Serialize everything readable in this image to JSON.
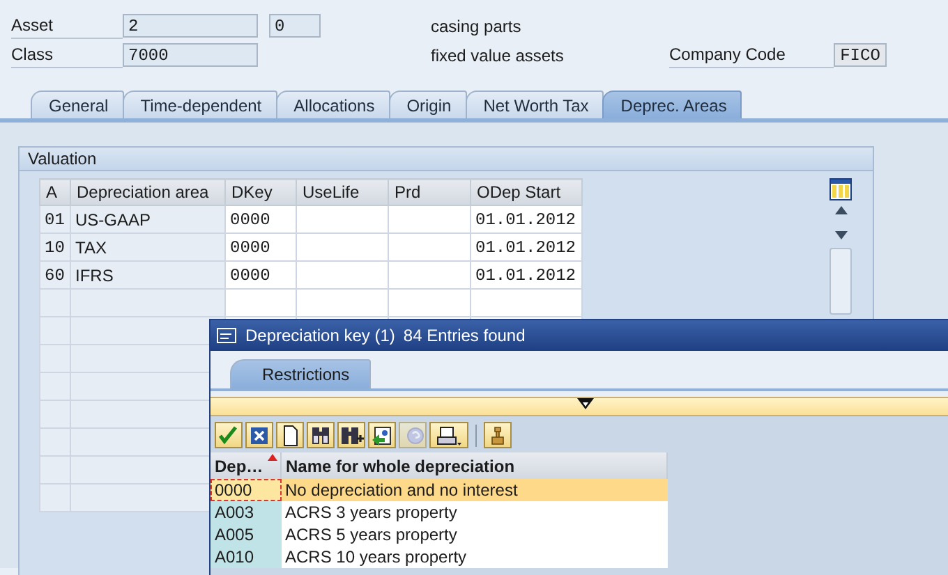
{
  "header": {
    "rows": [
      {
        "label": "Asset",
        "fields": [
          "2",
          "0"
        ],
        "description": "casing parts"
      },
      {
        "label": "Class",
        "fields": [
          "7000"
        ],
        "description": "fixed value assets",
        "extra_label": "Company Code",
        "extra_value": "FICO"
      }
    ]
  },
  "tabs": [
    {
      "label": "General",
      "selected": false
    },
    {
      "label": "Time-dependent",
      "selected": false
    },
    {
      "label": "Allocations",
      "selected": false
    },
    {
      "label": "Origin",
      "selected": false
    },
    {
      "label": "Net Worth Tax",
      "selected": false
    },
    {
      "label": "Deprec. Areas",
      "selected": true
    }
  ],
  "valuation": {
    "title": "Valuation",
    "columns": [
      "A",
      "Depreciation area",
      "DKey",
      "UseLife",
      "Prd",
      "ODep Start"
    ],
    "rows": [
      {
        "area_no": "01",
        "area": "US-GAAP",
        "dkey": "0000",
        "odep_start": "01.01.2012"
      },
      {
        "area_no": "10",
        "area": "TAX",
        "dkey": "0000",
        "odep_start": "01.01.2012"
      },
      {
        "area_no": "60",
        "area": "IFRS",
        "dkey": "0000",
        "odep_start": "01.01.2012"
      }
    ]
  },
  "popup": {
    "title": "Depreciation key (1)",
    "entries_found": "84 Entries found",
    "tabs": [
      {
        "label": "Restrictions",
        "selected": true
      }
    ],
    "toolbar": [
      {
        "kind": "check",
        "disabled": false
      },
      {
        "kind": "cancel",
        "disabled": false
      },
      {
        "kind": "page",
        "disabled": false
      },
      {
        "kind": "find",
        "disabled": false
      },
      {
        "kind": "find_next",
        "disabled": false
      },
      {
        "kind": "export",
        "disabled": false
      },
      {
        "kind": "help",
        "disabled": true
      },
      {
        "kind": "print",
        "disabled": false
      },
      {
        "kind": "tool",
        "disabled": false
      }
    ],
    "columns": [
      "Dep…",
      "Name for whole depreciation"
    ],
    "rows": [
      {
        "key": "0000",
        "name": "No depreciation and no interest",
        "selected": true
      },
      {
        "key": "A003",
        "name": "ACRS 3 years property",
        "selected": false
      },
      {
        "key": "A005",
        "name": "ACRS 5 years property",
        "selected": false
      },
      {
        "key": "A010",
        "name": "ACRS 10 years property",
        "selected": false
      }
    ]
  }
}
